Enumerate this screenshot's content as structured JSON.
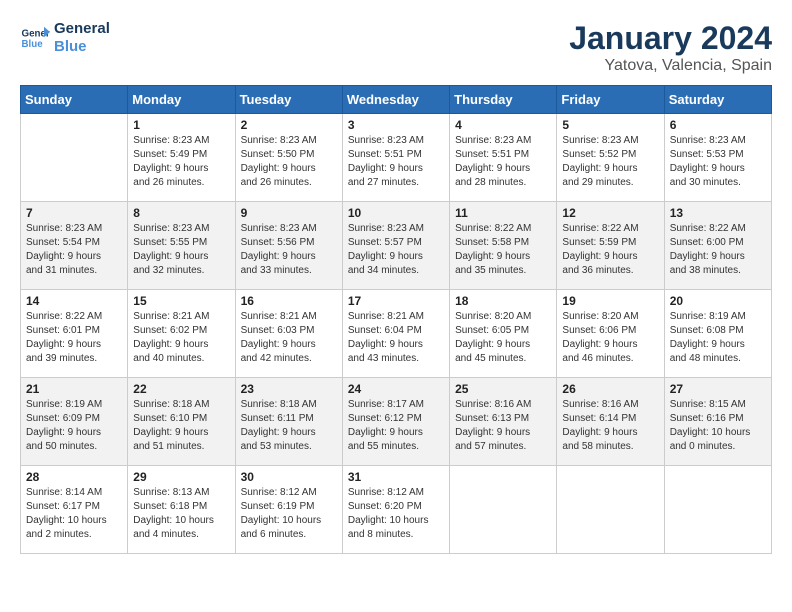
{
  "logo": {
    "line1": "General",
    "line2": "Blue"
  },
  "title": "January 2024",
  "location": "Yatova, Valencia, Spain",
  "days_of_week": [
    "Sunday",
    "Monday",
    "Tuesday",
    "Wednesday",
    "Thursday",
    "Friday",
    "Saturday"
  ],
  "weeks": [
    [
      {
        "day": "",
        "info": ""
      },
      {
        "day": "1",
        "info": "Sunrise: 8:23 AM\nSunset: 5:49 PM\nDaylight: 9 hours\nand 26 minutes."
      },
      {
        "day": "2",
        "info": "Sunrise: 8:23 AM\nSunset: 5:50 PM\nDaylight: 9 hours\nand 26 minutes."
      },
      {
        "day": "3",
        "info": "Sunrise: 8:23 AM\nSunset: 5:51 PM\nDaylight: 9 hours\nand 27 minutes."
      },
      {
        "day": "4",
        "info": "Sunrise: 8:23 AM\nSunset: 5:51 PM\nDaylight: 9 hours\nand 28 minutes."
      },
      {
        "day": "5",
        "info": "Sunrise: 8:23 AM\nSunset: 5:52 PM\nDaylight: 9 hours\nand 29 minutes."
      },
      {
        "day": "6",
        "info": "Sunrise: 8:23 AM\nSunset: 5:53 PM\nDaylight: 9 hours\nand 30 minutes."
      }
    ],
    [
      {
        "day": "7",
        "info": "Sunrise: 8:23 AM\nSunset: 5:54 PM\nDaylight: 9 hours\nand 31 minutes."
      },
      {
        "day": "8",
        "info": "Sunrise: 8:23 AM\nSunset: 5:55 PM\nDaylight: 9 hours\nand 32 minutes."
      },
      {
        "day": "9",
        "info": "Sunrise: 8:23 AM\nSunset: 5:56 PM\nDaylight: 9 hours\nand 33 minutes."
      },
      {
        "day": "10",
        "info": "Sunrise: 8:23 AM\nSunset: 5:57 PM\nDaylight: 9 hours\nand 34 minutes."
      },
      {
        "day": "11",
        "info": "Sunrise: 8:22 AM\nSunset: 5:58 PM\nDaylight: 9 hours\nand 35 minutes."
      },
      {
        "day": "12",
        "info": "Sunrise: 8:22 AM\nSunset: 5:59 PM\nDaylight: 9 hours\nand 36 minutes."
      },
      {
        "day": "13",
        "info": "Sunrise: 8:22 AM\nSunset: 6:00 PM\nDaylight: 9 hours\nand 38 minutes."
      }
    ],
    [
      {
        "day": "14",
        "info": "Sunrise: 8:22 AM\nSunset: 6:01 PM\nDaylight: 9 hours\nand 39 minutes."
      },
      {
        "day": "15",
        "info": "Sunrise: 8:21 AM\nSunset: 6:02 PM\nDaylight: 9 hours\nand 40 minutes."
      },
      {
        "day": "16",
        "info": "Sunrise: 8:21 AM\nSunset: 6:03 PM\nDaylight: 9 hours\nand 42 minutes."
      },
      {
        "day": "17",
        "info": "Sunrise: 8:21 AM\nSunset: 6:04 PM\nDaylight: 9 hours\nand 43 minutes."
      },
      {
        "day": "18",
        "info": "Sunrise: 8:20 AM\nSunset: 6:05 PM\nDaylight: 9 hours\nand 45 minutes."
      },
      {
        "day": "19",
        "info": "Sunrise: 8:20 AM\nSunset: 6:06 PM\nDaylight: 9 hours\nand 46 minutes."
      },
      {
        "day": "20",
        "info": "Sunrise: 8:19 AM\nSunset: 6:08 PM\nDaylight: 9 hours\nand 48 minutes."
      }
    ],
    [
      {
        "day": "21",
        "info": "Sunrise: 8:19 AM\nSunset: 6:09 PM\nDaylight: 9 hours\nand 50 minutes."
      },
      {
        "day": "22",
        "info": "Sunrise: 8:18 AM\nSunset: 6:10 PM\nDaylight: 9 hours\nand 51 minutes."
      },
      {
        "day": "23",
        "info": "Sunrise: 8:18 AM\nSunset: 6:11 PM\nDaylight: 9 hours\nand 53 minutes."
      },
      {
        "day": "24",
        "info": "Sunrise: 8:17 AM\nSunset: 6:12 PM\nDaylight: 9 hours\nand 55 minutes."
      },
      {
        "day": "25",
        "info": "Sunrise: 8:16 AM\nSunset: 6:13 PM\nDaylight: 9 hours\nand 57 minutes."
      },
      {
        "day": "26",
        "info": "Sunrise: 8:16 AM\nSunset: 6:14 PM\nDaylight: 9 hours\nand 58 minutes."
      },
      {
        "day": "27",
        "info": "Sunrise: 8:15 AM\nSunset: 6:16 PM\nDaylight: 10 hours\nand 0 minutes."
      }
    ],
    [
      {
        "day": "28",
        "info": "Sunrise: 8:14 AM\nSunset: 6:17 PM\nDaylight: 10 hours\nand 2 minutes."
      },
      {
        "day": "29",
        "info": "Sunrise: 8:13 AM\nSunset: 6:18 PM\nDaylight: 10 hours\nand 4 minutes."
      },
      {
        "day": "30",
        "info": "Sunrise: 8:12 AM\nSunset: 6:19 PM\nDaylight: 10 hours\nand 6 minutes."
      },
      {
        "day": "31",
        "info": "Sunrise: 8:12 AM\nSunset: 6:20 PM\nDaylight: 10 hours\nand 8 minutes."
      },
      {
        "day": "",
        "info": ""
      },
      {
        "day": "",
        "info": ""
      },
      {
        "day": "",
        "info": ""
      }
    ]
  ]
}
